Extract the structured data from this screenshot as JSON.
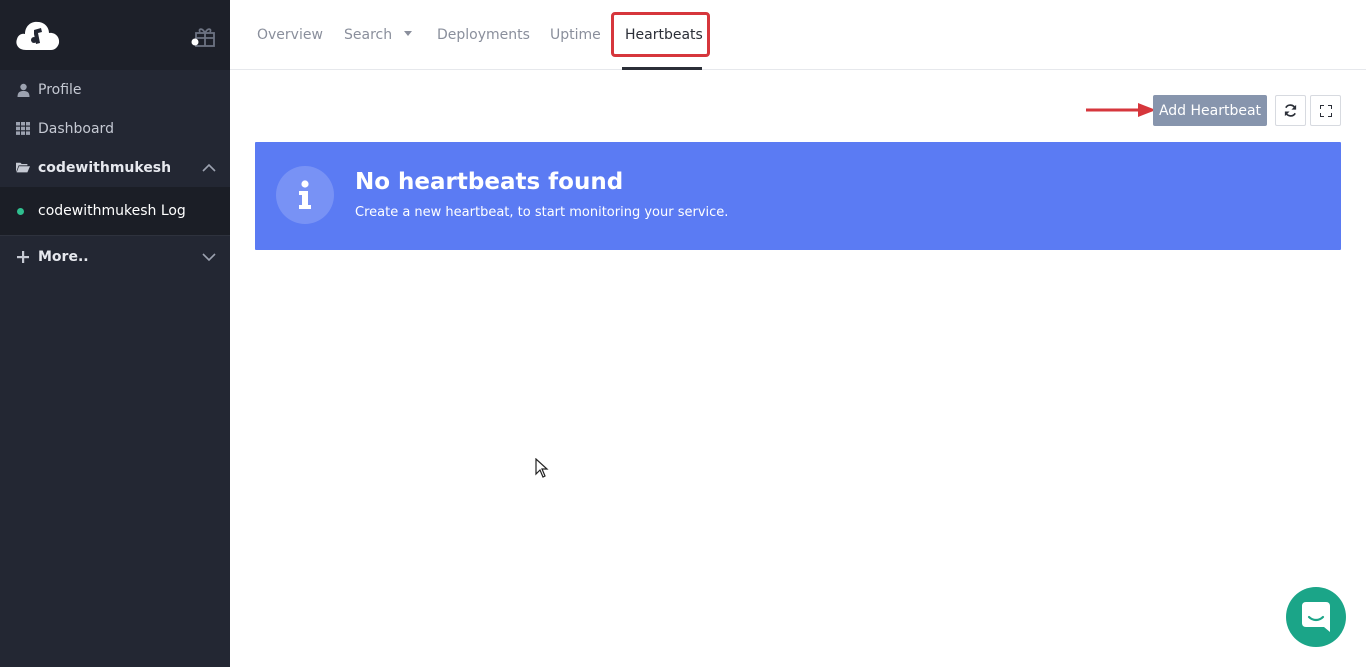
{
  "sidebar": {
    "items": [
      {
        "label": "Profile",
        "icon": "user-icon"
      },
      {
        "label": "Dashboard",
        "icon": "grid-icon"
      },
      {
        "label": "codewithmukesh",
        "icon": "folder-open-icon"
      },
      {
        "label": "codewithmukesh Log",
        "icon": "status-dot"
      },
      {
        "label": "More..",
        "icon": "plus-icon"
      }
    ]
  },
  "topnav": {
    "tabs": [
      {
        "label": "Overview"
      },
      {
        "label": "Search"
      },
      {
        "label": "Deployments"
      },
      {
        "label": "Uptime"
      },
      {
        "label": "Heartbeats"
      }
    ],
    "active": "Heartbeats"
  },
  "toolbar": {
    "add_label": "Add Heartbeat"
  },
  "alert": {
    "title": "No heartbeats found",
    "message": "Create a new heartbeat, to start monitoring your service."
  },
  "colors": {
    "sidebar_bg": "#232733",
    "alert_bg": "#5b7bf3",
    "primary_btn": "#8795ad",
    "highlight": "#d6363c",
    "chat": "#1ba588",
    "status_dot": "#2fbf8f"
  }
}
